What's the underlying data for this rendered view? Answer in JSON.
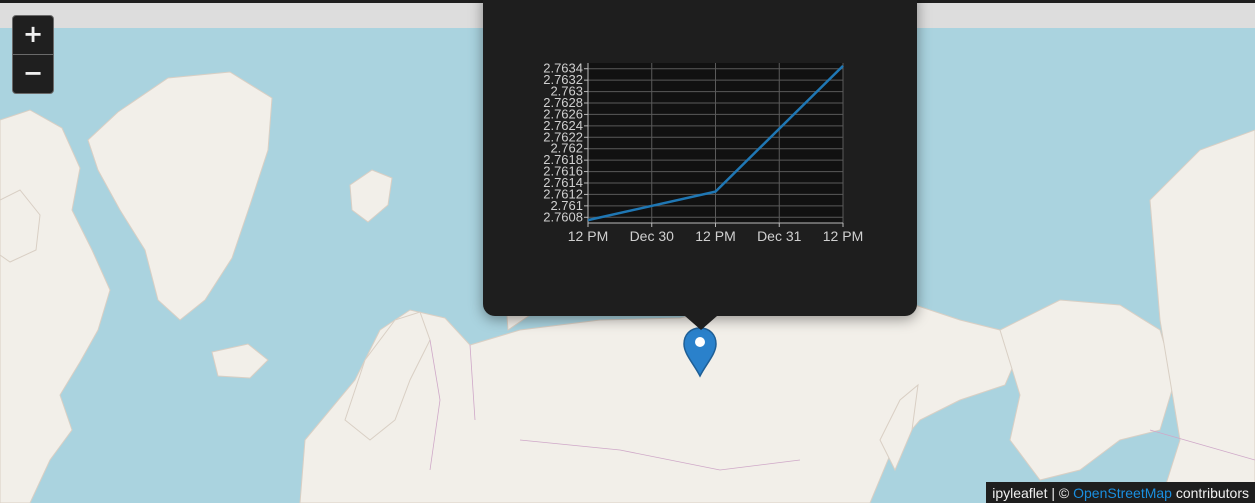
{
  "zoom": {
    "in_label": "+",
    "out_label": "−"
  },
  "attribution": {
    "library": "ipyleaflet",
    "separator": " | © ",
    "link_text": "OpenStreetMap",
    "suffix": " contributors"
  },
  "marker": {
    "icon": "map-marker-icon",
    "color": "#2a81cb"
  },
  "colors": {
    "water": "#aad3df",
    "land": "#f2efe9",
    "popup_bg": "#1e1e1e",
    "plot_bg": "#111111",
    "line": "#1f77b4"
  },
  "chart_data": {
    "type": "line",
    "title": "",
    "xlabel": "",
    "ylabel": "",
    "x_ticks": [
      "12 PM",
      "Dec 30",
      "12 PM",
      "Dec 31",
      "12 PM"
    ],
    "y_ticks": [
      "2.7608",
      "2.761",
      "2.7612",
      "2.7614",
      "2.7616",
      "2.7618",
      "2.762",
      "2.7622",
      "2.7624",
      "2.7626",
      "2.7628",
      "2.763",
      "2.7632",
      "2.7634"
    ],
    "ylim": [
      2.7607,
      2.7635
    ],
    "grid": true,
    "series": [
      {
        "x": [
          "12 PM",
          "12 PM",
          "12 PM"
        ],
        "values": [
          2.76075,
          2.76125,
          2.76345
        ]
      }
    ]
  }
}
